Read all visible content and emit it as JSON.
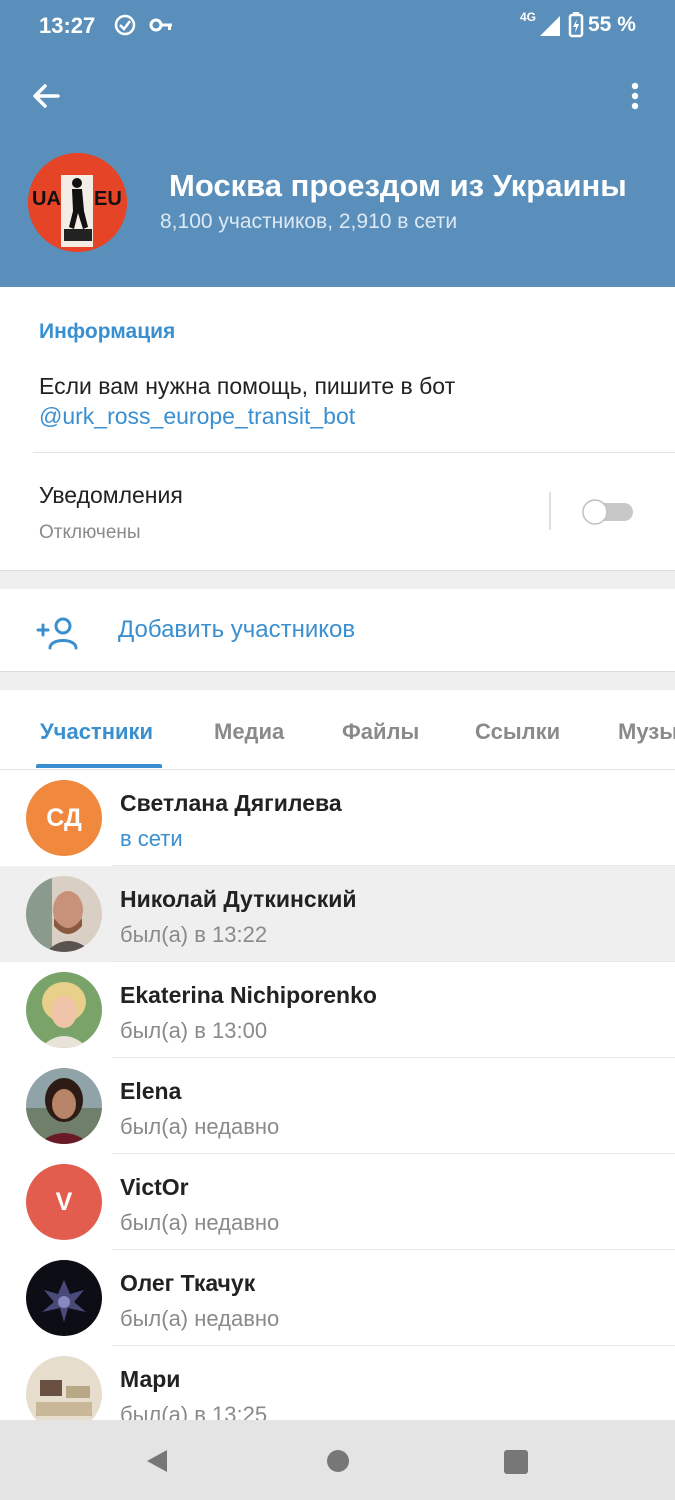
{
  "status_bar": {
    "time": "13:27",
    "network": "4G",
    "battery": "55 %"
  },
  "header": {
    "title": "Москва проездом из Украины",
    "subtitle": "8,100 участников, 2,910 в сети",
    "avatar_text_left": "UA",
    "avatar_text_right": "EU"
  },
  "info": {
    "heading": "Информация",
    "text": "Если вам нужна помощь, пишите в бот",
    "link": "@urk_ross_europe_transit_bot",
    "notifications_label": "Уведомления",
    "notifications_status": "Отключены",
    "notifications_on": false
  },
  "add_members_label": "Добавить участников",
  "tabs": [
    "Участники",
    "Медиа",
    "Файлы",
    "Ссылки",
    "Музыка"
  ],
  "active_tab": "Участники",
  "members": [
    {
      "name": "Светлана Дягилева",
      "status": "в сети",
      "initials": "СД",
      "avatar_color": "#f0883e",
      "online": true
    },
    {
      "name": "Николай Дуткинский",
      "status": "был(а) в 13:22",
      "avatar_color": "#a08070"
    },
    {
      "name": "Ekaterina Nichiporenko",
      "status": "был(а) в 13:00",
      "avatar_color": "#c9a86a"
    },
    {
      "name": "Elena",
      "status": "был(а) недавно",
      "avatar_color": "#7a5040"
    },
    {
      "name": "VictOr",
      "status": "был(а) недавно",
      "initials": "V",
      "avatar_color": "#e35d4f"
    },
    {
      "name": "Олег Ткачук",
      "status": "был(а) недавно",
      "avatar_color": "#141420"
    },
    {
      "name": "Мари",
      "status": "был(а) в 13:25",
      "avatar_color": "#cbb89a"
    }
  ],
  "colors": {
    "header_bg": "#5a8fbb",
    "accent": "#3a8fd0"
  }
}
